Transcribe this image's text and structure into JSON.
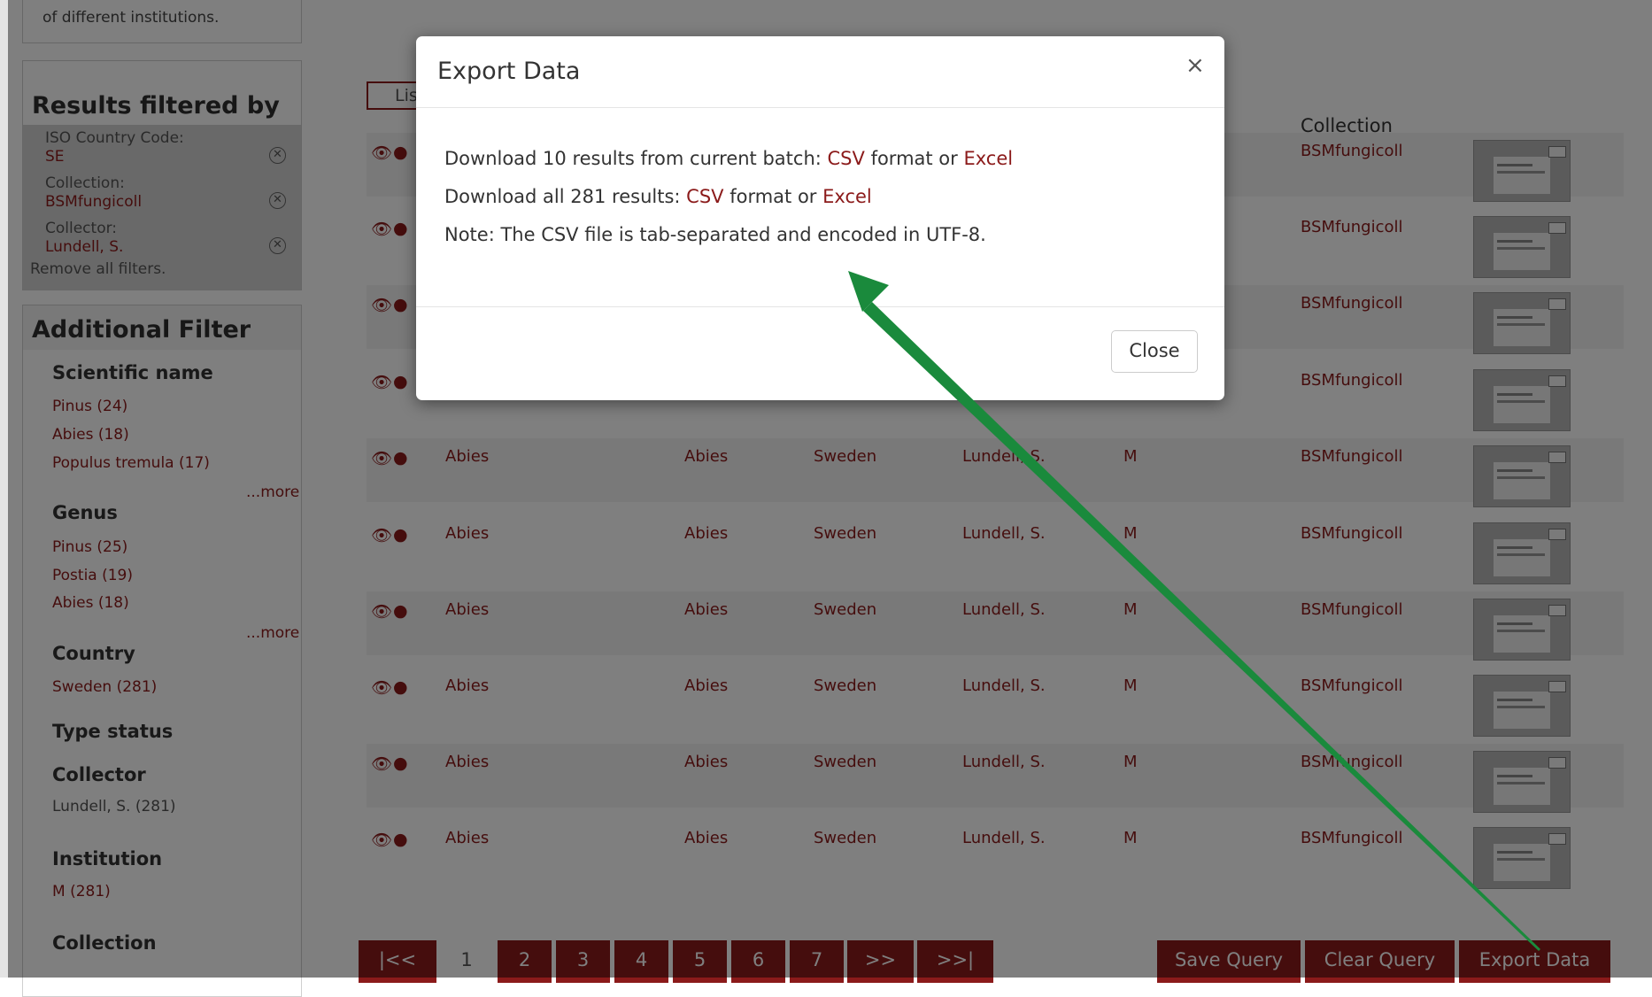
{
  "sidebar": {
    "intro_text": "of different institutions.",
    "filtered_title": "Results filtered by",
    "filters": [
      {
        "label": "ISO Country Code:",
        "value": "SE"
      },
      {
        "label": "Collection:",
        "value": "BSMfungicoll"
      },
      {
        "label": "Collector:",
        "value": "Lundell, S."
      }
    ],
    "remove_all": "Remove all filters.",
    "additional_title": "Additional Filter",
    "facets": {
      "scientific_name": {
        "heading": "Scientific name",
        "items": [
          "Pinus (24)",
          "Abies (18)",
          "Populus tremula (17)"
        ],
        "more": "...more"
      },
      "genus": {
        "heading": "Genus",
        "items": [
          "Pinus (25)",
          "Postia (19)",
          "Abies (18)"
        ],
        "more": "...more"
      },
      "country": {
        "heading": "Country",
        "items": [
          "Sweden (281)"
        ]
      },
      "type_status": {
        "heading": "Type status"
      },
      "collector": {
        "heading": "Collector",
        "items": [
          "Lundell, S. (281)"
        ]
      },
      "institution": {
        "heading": "Institution",
        "items": [
          "M (281)"
        ]
      },
      "collection": {
        "heading": "Collection"
      }
    }
  },
  "main": {
    "list_tab": "List",
    "collection_header": "Collection",
    "rows": [
      {
        "name": "",
        "genus": "",
        "country": "",
        "collector": "",
        "institution": "",
        "collection": "BSMfungicoll"
      },
      {
        "name": "",
        "genus": "",
        "country": "",
        "collector": "",
        "institution": "",
        "collection": "BSMfungicoll"
      },
      {
        "name": "",
        "genus": "",
        "country": "",
        "collector": "",
        "institution": "",
        "collection": "BSMfungicoll"
      },
      {
        "name": "",
        "genus": "",
        "country": "",
        "collector": "",
        "institution": "",
        "collection": "BSMfungicoll"
      },
      {
        "name": "Abies",
        "genus": "Abies",
        "country": "Sweden",
        "collector": "Lundell, S.",
        "institution": "M",
        "collection": "BSMfungicoll"
      },
      {
        "name": "Abies",
        "genus": "Abies",
        "country": "Sweden",
        "collector": "Lundell, S.",
        "institution": "M",
        "collection": "BSMfungicoll"
      },
      {
        "name": "Abies",
        "genus": "Abies",
        "country": "Sweden",
        "collector": "Lundell, S.",
        "institution": "M",
        "collection": "BSMfungicoll"
      },
      {
        "name": "Abies",
        "genus": "Abies",
        "country": "Sweden",
        "collector": "Lundell, S.",
        "institution": "M",
        "collection": "BSMfungicoll"
      },
      {
        "name": "Abies",
        "genus": "Abies",
        "country": "Sweden",
        "collector": "Lundell, S.",
        "institution": "M",
        "collection": "BSMfungicoll"
      },
      {
        "name": "Abies",
        "genus": "Abies",
        "country": "Sweden",
        "collector": "Lundell, S.",
        "institution": "M",
        "collection": "BSMfungicoll"
      }
    ],
    "icons": {
      "view": "eye-icon",
      "map": "globe-icon"
    },
    "pagination": [
      "|<<",
      "1",
      "2",
      "3",
      "4",
      "5",
      "6",
      "7",
      ">>",
      ">>|"
    ],
    "current_page": "1",
    "actions": {
      "save": "Save Query",
      "clear": "Clear Query",
      "export": "Export Data"
    }
  },
  "modal": {
    "title": "Export Data",
    "close_x": "×",
    "line1_prefix": "Download 10 results from current batch:",
    "line1_csv": "CSV",
    "line1_mid": "format or",
    "line1_excel": "Excel",
    "line2_prefix": "Download all 281 results:",
    "line2_csv": "CSV",
    "line2_mid": "format or",
    "line2_excel": "Excel",
    "note": "Note: The CSV file is tab-separated and encoded in UTF-8.",
    "close_button": "Close"
  },
  "colors": {
    "accent": "#8b1a1a",
    "annotation_arrow": "#1a8a3c"
  }
}
